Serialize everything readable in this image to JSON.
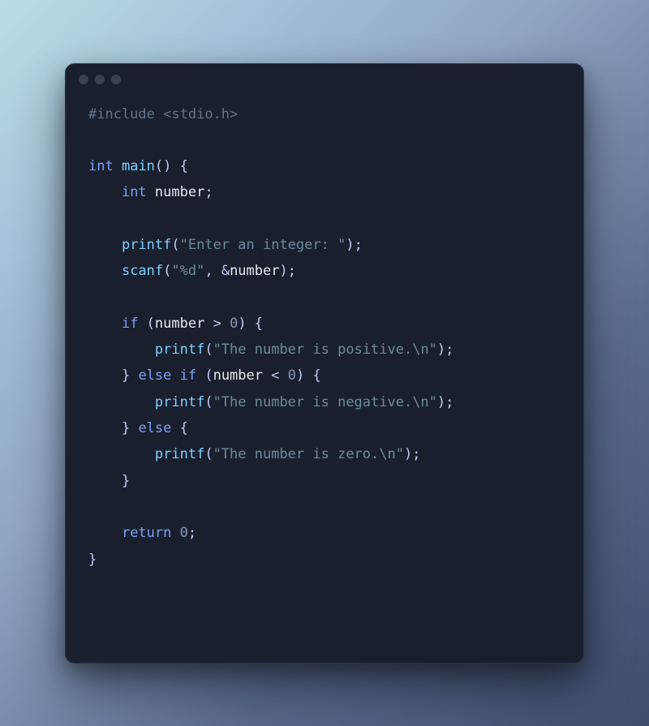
{
  "code": {
    "line1_include": "#include",
    "line1_header": "<stdio.h>",
    "line2_type": "int",
    "line2_fn": "main",
    "line2_paren": "()",
    "line2_brace": " {",
    "line3_indent": "    ",
    "line3_type": "int",
    "line3_ident": " number",
    "line3_semi": ";",
    "line4_blank": "",
    "line5_indent": "    ",
    "line5_fn": "printf",
    "line5_open": "(",
    "line5_str": "\"Enter an integer: \"",
    "line5_close": ");",
    "line6_indent": "    ",
    "line6_fn": "scanf",
    "line6_open": "(",
    "line6_str": "\"%d\"",
    "line6_comma": ", &",
    "line6_ident": "number",
    "line6_close": ");",
    "line7_blank": "",
    "line8_indent": "    ",
    "line8_kw": "if",
    "line8_open": " (",
    "line8_ident": "number",
    "line8_op": " > ",
    "line8_num": "0",
    "line8_close": ") {",
    "line9_indent": "        ",
    "line9_fn": "printf",
    "line9_open": "(",
    "line9_str": "\"The number is positive.\\n\"",
    "line9_close": ");",
    "line10_indent": "    ",
    "line10_close": "}",
    "line10_kw": " else if",
    "line10_open": " (",
    "line10_ident": "number",
    "line10_op": " < ",
    "line10_num": "0",
    "line10_close2": ") {",
    "line11_indent": "        ",
    "line11_fn": "printf",
    "line11_open": "(",
    "line11_str": "\"The number is negative.\\n\"",
    "line11_close": ");",
    "line12_indent": "    ",
    "line12_close": "}",
    "line12_kw": " else",
    "line12_brace": " {",
    "line13_indent": "        ",
    "line13_fn": "printf",
    "line13_open": "(",
    "line13_str": "\"The number is zero.\\n\"",
    "line13_close": ");",
    "line14_indent": "    ",
    "line14_close": "}",
    "line15_blank": "",
    "line16_indent": "    ",
    "line16_kw": "return",
    "line16_sp": " ",
    "line16_num": "0",
    "line16_semi": ";",
    "line17_close": "}"
  }
}
